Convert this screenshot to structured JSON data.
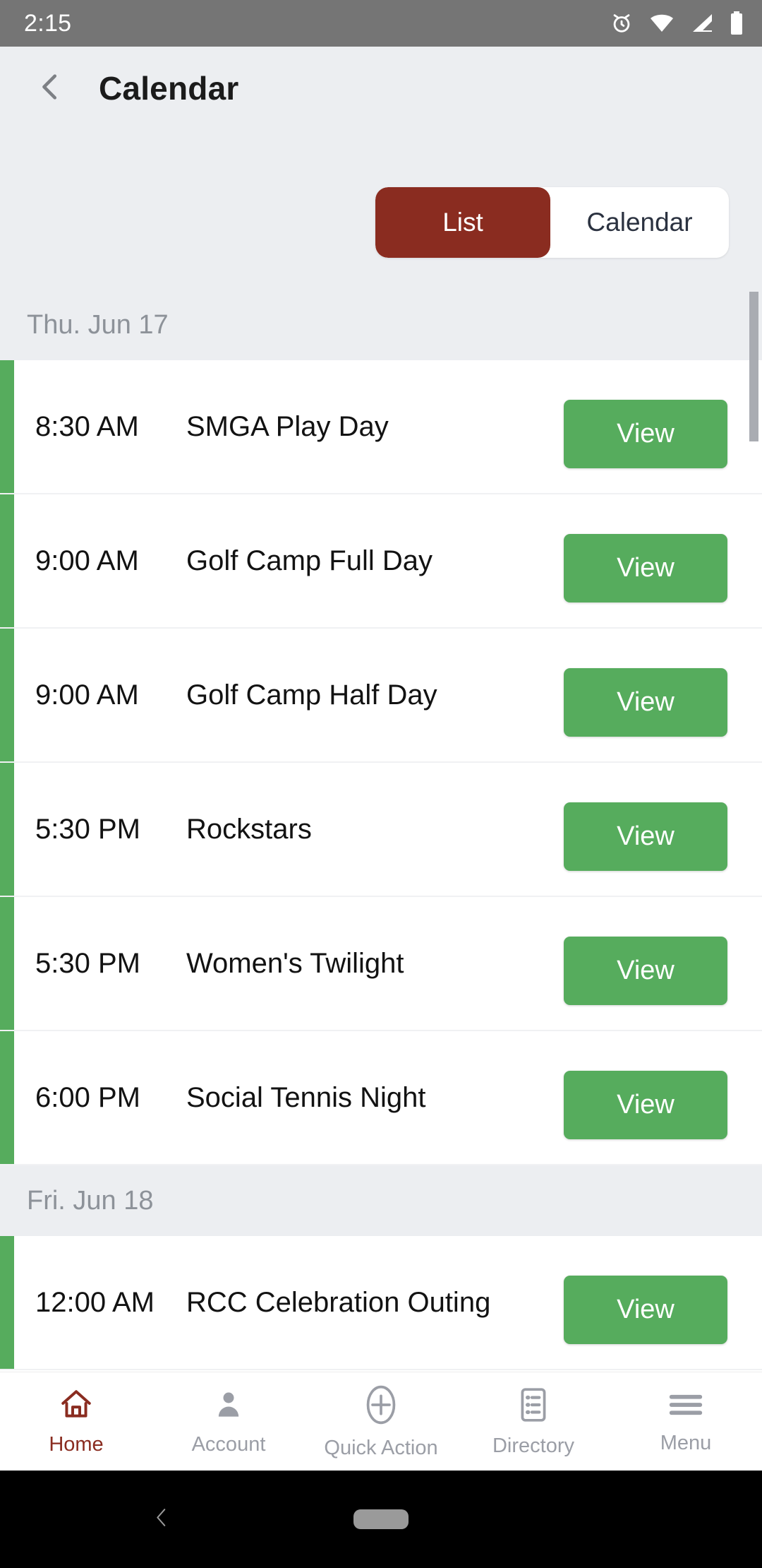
{
  "status_bar": {
    "time": "2:15",
    "icons": [
      "alarm-icon",
      "wifi-icon",
      "signal-icon",
      "battery-icon"
    ]
  },
  "header": {
    "back_icon": "chevron-left-icon",
    "title": "Calendar"
  },
  "view_toggle": {
    "options": [
      {
        "label": "List",
        "active": true
      },
      {
        "label": "Calendar",
        "active": false
      }
    ],
    "active_bg": "#8a2c20",
    "inactive_bg": "#ffffff",
    "active_text": "#ffffff",
    "inactive_text": "#2b3240"
  },
  "colors": {
    "accent_red": "#8a2c20",
    "event_green": "#56ac5d",
    "page_bg": "#eceef1",
    "day_header_text": "#8d9299",
    "status_bar_bg": "#757575"
  },
  "agenda": {
    "groups": [
      {
        "date_label": "Thu. Jun 17",
        "events": [
          {
            "time": "8:30 AM",
            "title": "SMGA Play Day",
            "action": "View"
          },
          {
            "time": "9:00 AM",
            "title": "Golf Camp Full Day",
            "action": "View"
          },
          {
            "time": "9:00 AM",
            "title": "Golf Camp Half Day",
            "action": "View"
          },
          {
            "time": "5:30 PM",
            "title": "Rockstars",
            "action": "View"
          },
          {
            "time": "5:30 PM",
            "title": "Women's Twilight",
            "action": "View"
          },
          {
            "time": "6:00 PM",
            "title": "Social Tennis Night",
            "action": "View"
          }
        ]
      },
      {
        "date_label": "Fri. Jun 18",
        "events": [
          {
            "time": "12:00 AM",
            "title": "RCC Celebration Outing",
            "action": "View"
          }
        ]
      }
    ]
  },
  "bottom_nav": {
    "items": [
      {
        "label": "Home",
        "icon": "home-icon",
        "active": true
      },
      {
        "label": "Account",
        "icon": "person-icon",
        "active": false
      },
      {
        "label": "Quick Action",
        "icon": "plus-circle-icon",
        "active": false
      },
      {
        "label": "Directory",
        "icon": "list-document-icon",
        "active": false
      },
      {
        "label": "Menu",
        "icon": "hamburger-icon",
        "active": false
      }
    ]
  },
  "system_nav": {
    "back_icon": "system-back-icon",
    "home_pill": "system-home-pill"
  }
}
